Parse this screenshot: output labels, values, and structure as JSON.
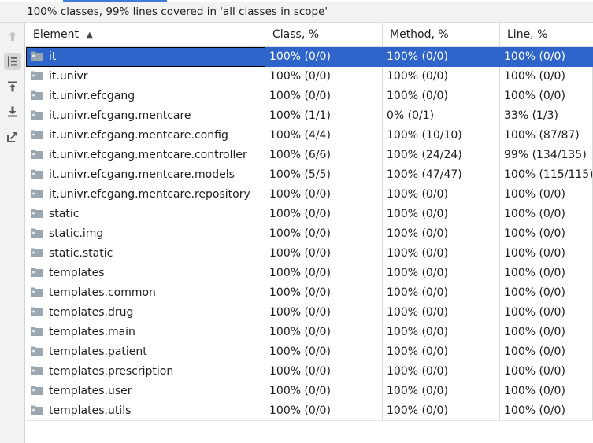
{
  "summary": "100% classes, 99% lines covered in 'all classes in scope'",
  "colors": {
    "selection": "#2f65ca",
    "folder": "#9aa7b0",
    "accent": "#3d7bd5"
  },
  "toolbar": {
    "buttons": [
      {
        "icon": "arrow-up-icon"
      },
      {
        "icon": "flatten-packages-icon",
        "active": true
      },
      {
        "icon": "export-top-icon"
      },
      {
        "icon": "export-bottom-icon"
      },
      {
        "icon": "navigate-external-icon"
      }
    ]
  },
  "table": {
    "columns": [
      "Element",
      "Class, %",
      "Method, %",
      "Line, %"
    ],
    "sort_column": "Element",
    "sort_direction": "ascending",
    "rows": [
      {
        "element": "it",
        "class": "100% (0/0)",
        "method": "100% (0/0)",
        "line": "100% (0/0)",
        "selected": true
      },
      {
        "element": "it.univr",
        "class": "100% (0/0)",
        "method": "100% (0/0)",
        "line": "100% (0/0)"
      },
      {
        "element": "it.univr.efcgang",
        "class": "100% (0/0)",
        "method": "100% (0/0)",
        "line": "100% (0/0)"
      },
      {
        "element": "it.univr.efcgang.mentcare",
        "class": "100% (1/1)",
        "method": "0% (0/1)",
        "line": "33% (1/3)"
      },
      {
        "element": "it.univr.efcgang.mentcare.config",
        "class": "100% (4/4)",
        "method": "100% (10/10)",
        "line": "100% (87/87)"
      },
      {
        "element": "it.univr.efcgang.mentcare.controller",
        "class": "100% (6/6)",
        "method": "100% (24/24)",
        "line": "99% (134/135)"
      },
      {
        "element": "it.univr.efcgang.mentcare.models",
        "class": "100% (5/5)",
        "method": "100% (47/47)",
        "line": "100% (115/115)"
      },
      {
        "element": "it.univr.efcgang.mentcare.repository",
        "class": "100% (0/0)",
        "method": "100% (0/0)",
        "line": "100% (0/0)"
      },
      {
        "element": "static",
        "class": "100% (0/0)",
        "method": "100% (0/0)",
        "line": "100% (0/0)"
      },
      {
        "element": "static.img",
        "class": "100% (0/0)",
        "method": "100% (0/0)",
        "line": "100% (0/0)"
      },
      {
        "element": "static.static",
        "class": "100% (0/0)",
        "method": "100% (0/0)",
        "line": "100% (0/0)"
      },
      {
        "element": "templates",
        "class": "100% (0/0)",
        "method": "100% (0/0)",
        "line": "100% (0/0)"
      },
      {
        "element": "templates.common",
        "class": "100% (0/0)",
        "method": "100% (0/0)",
        "line": "100% (0/0)"
      },
      {
        "element": "templates.drug",
        "class": "100% (0/0)",
        "method": "100% (0/0)",
        "line": "100% (0/0)"
      },
      {
        "element": "templates.main",
        "class": "100% (0/0)",
        "method": "100% (0/0)",
        "line": "100% (0/0)"
      },
      {
        "element": "templates.patient",
        "class": "100% (0/0)",
        "method": "100% (0/0)",
        "line": "100% (0/0)"
      },
      {
        "element": "templates.prescription",
        "class": "100% (0/0)",
        "method": "100% (0/0)",
        "line": "100% (0/0)"
      },
      {
        "element": "templates.user",
        "class": "100% (0/0)",
        "method": "100% (0/0)",
        "line": "100% (0/0)"
      },
      {
        "element": "templates.utils",
        "class": "100% (0/0)",
        "method": "100% (0/0)",
        "line": "100% (0/0)"
      }
    ]
  }
}
